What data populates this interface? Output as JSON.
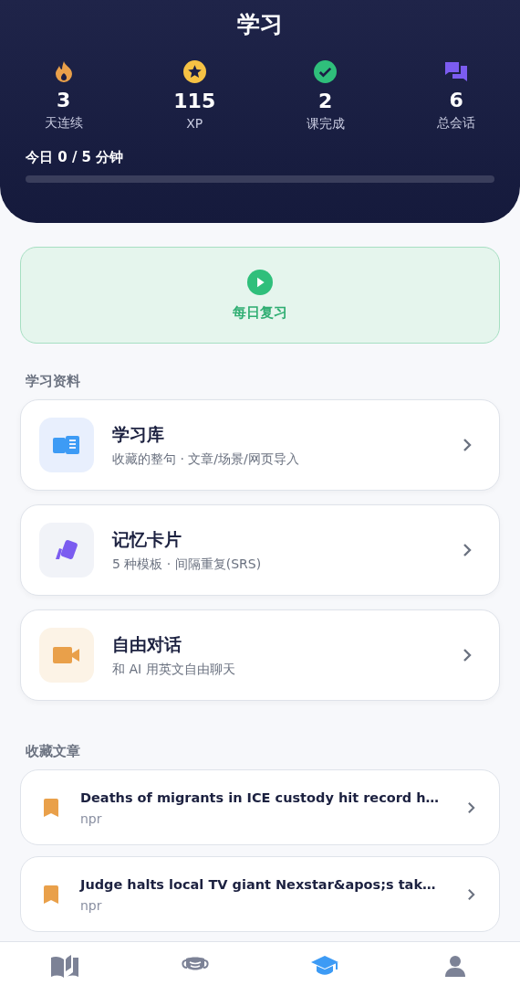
{
  "header": {
    "title": "学习",
    "stats": [
      {
        "kind": "flame",
        "value": "3",
        "label": "天连续"
      },
      {
        "kind": "star",
        "value": "115",
        "label": "XP"
      },
      {
        "kind": "check",
        "value": "2",
        "label": "课完成"
      },
      {
        "kind": "chat",
        "value": "6",
        "label": "总会话"
      }
    ],
    "today": {
      "label": "今日 0 / 5 分钟",
      "level": 0
    }
  },
  "daily_review": {
    "label": "每日复习"
  },
  "materials": {
    "heading": "学习资料",
    "items": [
      {
        "kind": "book",
        "title": "学习库",
        "subtitle": "收藏的整句 · 文章/场景/网页导入"
      },
      {
        "kind": "cards",
        "title": "记忆卡片",
        "subtitle": "5 种模板 · 间隔重复(SRS)"
      },
      {
        "kind": "video",
        "title": "自由对话",
        "subtitle": "和 AI 用英文自由聊天"
      }
    ]
  },
  "saved_articles": {
    "heading": "收藏文章",
    "items": [
      {
        "title": "Deaths of migrants in ICE custody hit record h…",
        "source": "npr"
      },
      {
        "title": "Judge halts local TV giant Nexstar&apos;s tak…",
        "source": "npr"
      }
    ]
  },
  "bottom_nav": [
    {
      "kind": "book",
      "selected": false
    },
    {
      "kind": "mask",
      "selected": false
    },
    {
      "kind": "cap",
      "selected": true
    },
    {
      "kind": "person",
      "selected": false
    }
  ]
}
